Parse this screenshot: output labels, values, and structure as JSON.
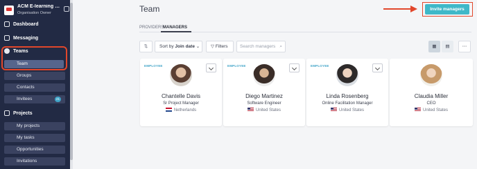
{
  "org": {
    "name": "ACM E-learning S...",
    "role": "Organisation Owner"
  },
  "nav": {
    "dashboard": "Dashboard",
    "messaging": "Messaging",
    "teams": "Teams",
    "team": "Team",
    "groups": "Groups",
    "contacts": "Contacts",
    "invitees": "Invitees",
    "invitees_count": "21",
    "projects": "Projects",
    "my_projects": "My projects",
    "my_tasks": "My tasks",
    "opportunities": "Opportunities",
    "invitations": "Invitations"
  },
  "header": {
    "title": "Team",
    "invite_label": "Invite managers"
  },
  "tabs": [
    {
      "label": "PROVIDERS"
    },
    {
      "label": "MANAGERS"
    }
  ],
  "toolbar": {
    "sort_prefix": "Sort by ",
    "sort_value": "Join date",
    "filters_label": "Filters",
    "search_placeholder": "Search managers"
  },
  "cards": [
    {
      "tag": "EMPLOYEE",
      "name": "Chantelle Davis",
      "role": "Sr Project Manager",
      "country": "Netherlands",
      "flag": "nl"
    },
    {
      "tag": "EMPLOYEE",
      "name": "Diego Martinez",
      "role": "Software Engineer",
      "country": "United States",
      "flag": "us"
    },
    {
      "tag": "EMPLOYEE",
      "name": "Linda Rosenberg",
      "role": "Online Facilitation Manager",
      "country": "United States",
      "flag": "us"
    },
    {
      "tag": "",
      "name": "Claudia Miller",
      "role": "CEO",
      "country": "United States",
      "flag": "us"
    }
  ],
  "colors": {
    "sidebar": "#222a44",
    "accent": "#3fb8c8",
    "annotation": "#e2472b"
  }
}
